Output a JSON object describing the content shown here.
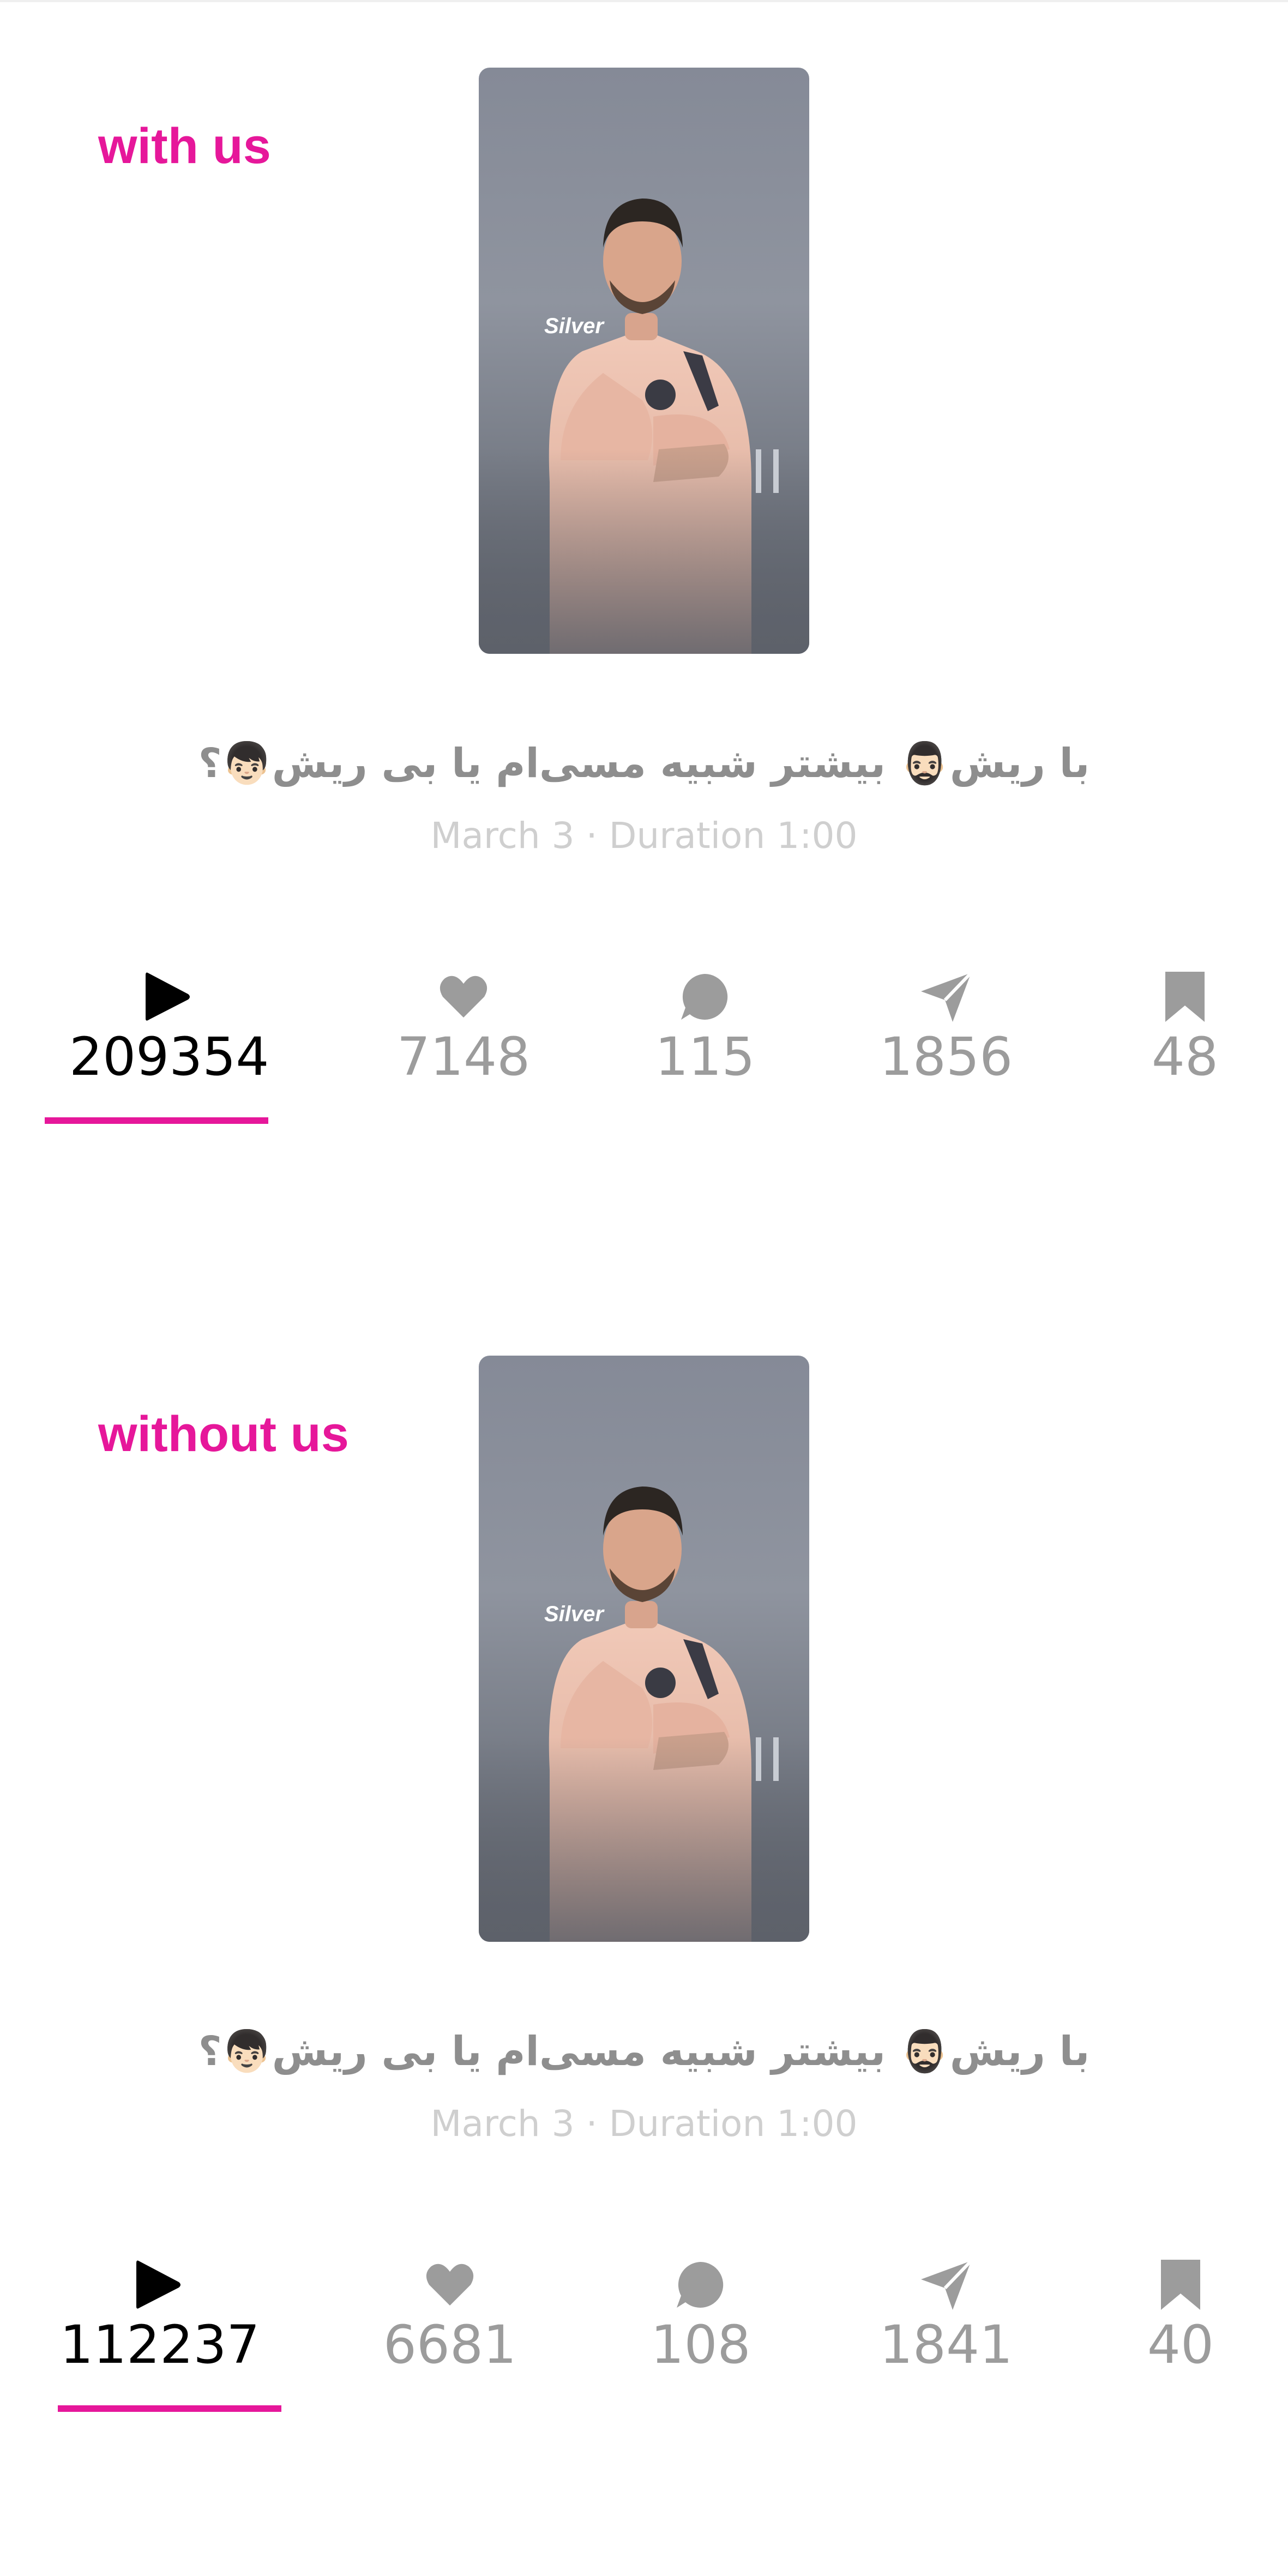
{
  "accent_color": "#e6179a",
  "posts": [
    {
      "label": "with us",
      "caption": "با ریش🧔🏻‍♂️ بیشتر شبیه مسی‌ام یا بی ریش👦🏻؟",
      "meta": "March 3 · Duration 1:00",
      "thumbnail_brand": "Silver",
      "stats": {
        "views": "209354",
        "likes": "7148",
        "comments": "115",
        "shares": "1856",
        "saves": "48"
      }
    },
    {
      "label": "without us",
      "caption": "با ریش🧔🏻‍♂️ بیشتر شبیه مسی‌ام یا بی ریش👦🏻؟",
      "meta": "March 3 · Duration 1:00",
      "thumbnail_brand": "Silver",
      "stats": {
        "views": "112237",
        "likes": "6681",
        "comments": "108",
        "shares": "1841",
        "saves": "40"
      }
    }
  ],
  "icons": {
    "views": "play-icon",
    "likes": "heart-icon",
    "comments": "comment-bubble-icon",
    "shares": "send-icon",
    "saves": "bookmark-icon"
  }
}
